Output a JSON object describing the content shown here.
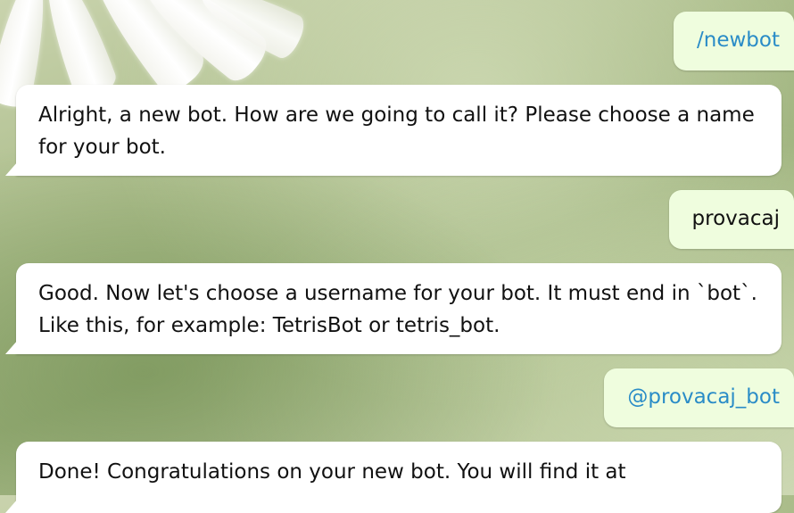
{
  "chat": {
    "messages": [
      {
        "direction": "out",
        "text": "/newbot",
        "is_command": true
      },
      {
        "direction": "in",
        "text": "Alright, a new bot. How are we going to call it? Please choose a name for your bot."
      },
      {
        "direction": "out",
        "text": "provacaj",
        "is_command": false
      },
      {
        "direction": "in",
        "text": "Good. Now let's choose a username for your bot. It must end in `bot`. Like this, for example: TetrisBot or tetris_bot."
      },
      {
        "direction": "out",
        "text": "@provacaj_bot",
        "is_command": true
      },
      {
        "direction": "in",
        "text": "Done! Congratulations on your new bot. You will find it at"
      }
    ]
  },
  "colors": {
    "incoming_bubble": "#ffffff",
    "outgoing_bubble": "#effdde",
    "link": "#2a8cc7",
    "text": "#111111"
  }
}
